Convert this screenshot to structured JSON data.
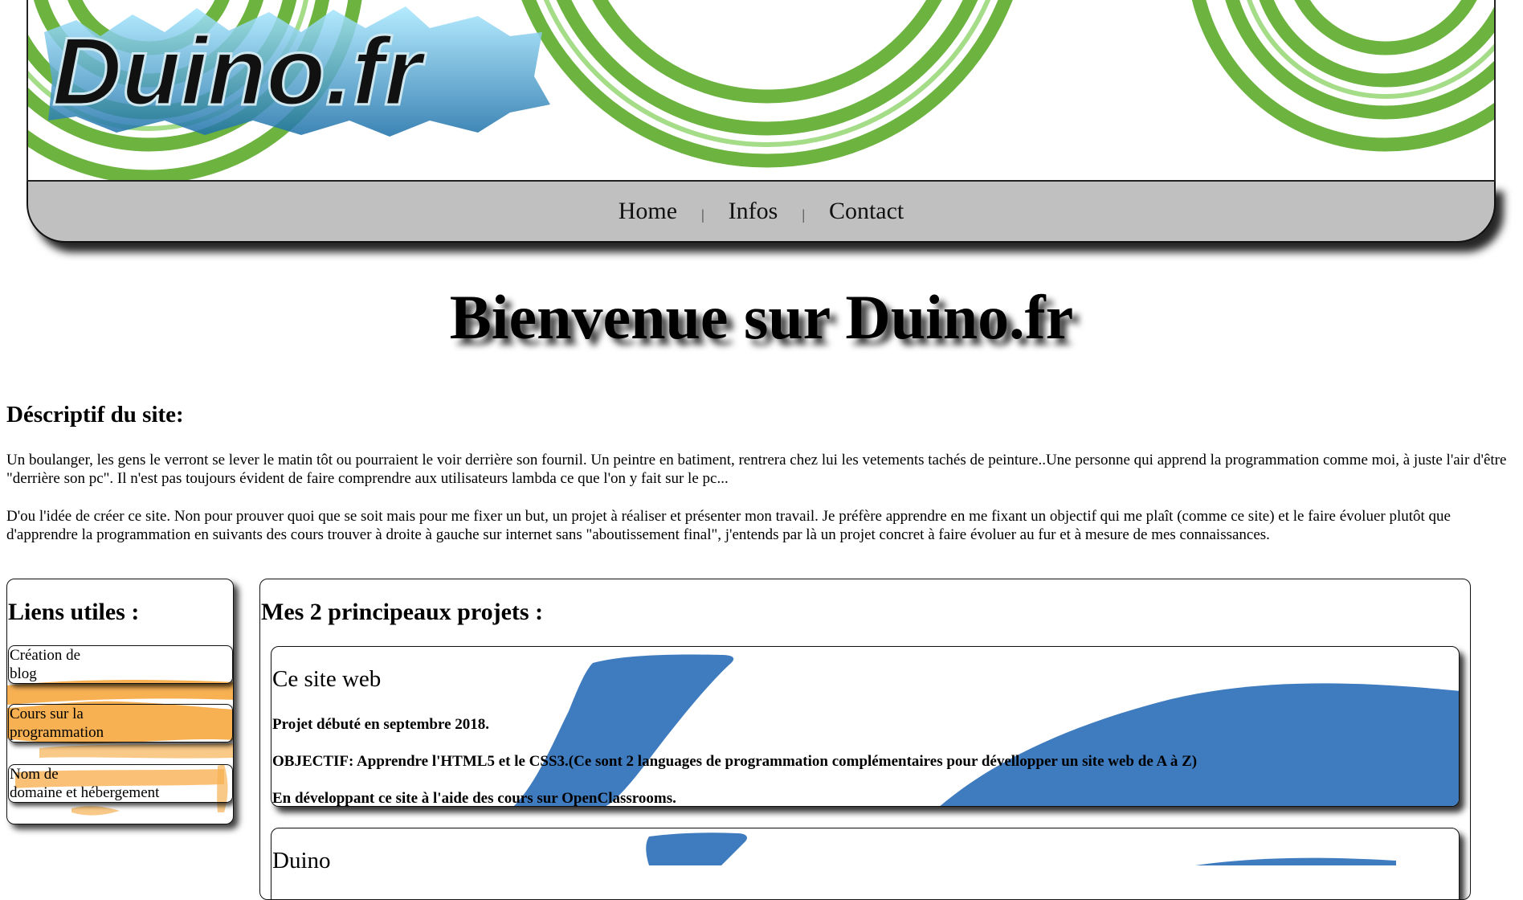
{
  "banner": {
    "logo_text": "Duino.fr",
    "ring_color": "#6cb33f"
  },
  "nav": {
    "items": [
      "Home",
      "Infos",
      "Contact"
    ],
    "separator": "|"
  },
  "main": {
    "title": "Bienvenue sur Duino.fr",
    "description_heading": "Déscriptif du site:",
    "paragraphs": [
      "Un boulanger, les gens le verront se lever le matin tôt ou pourraient le voir derrière son fournil. Un peintre en batiment, rentrera chez lui les vetements tachés de peinture..Une personne qui apprend la programmation comme moi, à juste l'air d'être \"derrière son pc\". Il n'est pas toujours évident de faire comprendre aux utilisateurs lambda ce que l'on y fait sur le pc...",
      "D'ou l'idée de créer ce site. Non pour prouver quoi que se soit mais pour me fixer un but, un projet à réaliser et présenter mon travail. Je préfère apprendre en me fixant un objectif qui me plaît (comme ce site) et le faire évoluer plutôt que d'apprendre la programmation en suivants des cours trouver à droite à gauche sur internet sans \"aboutissement final\", j'entends par là un projet concret à faire évoluer au fur et à mesure de mes connaissances."
    ]
  },
  "links": {
    "title": "Liens utiles :",
    "items": [
      {
        "line1": "Création de",
        "line2": "blog"
      },
      {
        "line1": "Cours sur la",
        "line2": "programmation"
      },
      {
        "line1": "Nom de",
        "line2": "domaine et hébergement"
      }
    ],
    "accent_color": "#f7a941"
  },
  "projects": {
    "title": "Mes 2 principeaux projets :",
    "items": [
      {
        "name": "Ce site web",
        "lines": [
          "Projet débuté en septembre 2018.",
          "OBJECTIF: Apprendre l'HTML5 et le CSS3.(Ce sont 2 languages de programmation complémentaires pour dévellopper un site web de A à Z)",
          "En développant ce site à l'aide des cours sur OpenClassrooms."
        ]
      },
      {
        "name": "Duino"
      }
    ],
    "accent_color": "#3f7bbf"
  }
}
